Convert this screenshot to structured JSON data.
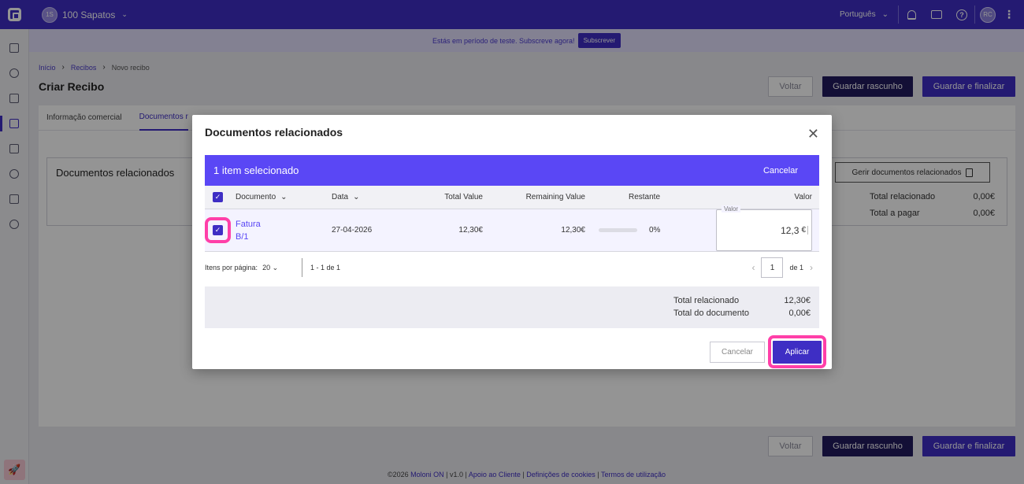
{
  "topbar": {
    "company_initials": "1S",
    "company_name": "100 Sapatos",
    "language": "Português",
    "user_initials": "RC"
  },
  "trial": {
    "message": "Estás em período de teste. Subscreve agora!",
    "subscribe_label": "Subscrever"
  },
  "breadcrumb": {
    "items": [
      "Início",
      "Recibos",
      "Novo recibo"
    ]
  },
  "page": {
    "title": "Criar Recibo",
    "back_label": "Voltar",
    "save_draft_label": "Guardar rascunho",
    "save_finalize_label": "Guardar e finalizar"
  },
  "tabs": [
    "Informação comercial",
    "Documentos r"
  ],
  "related_panel": {
    "title": "Documentos relacionados",
    "manage_label": "Gerir documentos relacionados",
    "total_related_label": "Total relacionado",
    "total_related_value": "0,00€",
    "total_pay_label": "Total a pagar",
    "total_pay_value": "0,00€"
  },
  "modal": {
    "title": "Documentos relacionados",
    "selection_text": "1 item selecionado",
    "selection_cancel": "Cancelar",
    "columns": {
      "documento": "Documento",
      "data": "Data",
      "total_value": "Total Value",
      "remaining_value": "Remaining Value",
      "restante": "Restante",
      "valor": "Valor"
    },
    "row": {
      "doc_line1": "Fatura",
      "doc_line2": "B/1",
      "date": "27-04-2026",
      "total_value": "12,30€",
      "remaining_value": "12,30€",
      "restante_pct": "0%",
      "restante_fraction": 0,
      "valor_label": "Valor",
      "valor": "12,3",
      "valor_unit": "€"
    },
    "pager": {
      "items_per_page_label": "Itens por página:",
      "items_per_page": "20",
      "range": "1 - 1 de 1",
      "page": "1",
      "of": "de 1"
    },
    "summary": {
      "related_label": "Total relacionado",
      "related_value": "12,30€",
      "doc_label": "Total do documento",
      "doc_value": "0,00€"
    },
    "cancel_label": "Cancelar",
    "apply_label": "Aplicar"
  },
  "footer": {
    "copyright": "©2026",
    "brand": "Moloni ON",
    "version": "| v1.0 |",
    "support": "Apoio ao Cliente",
    "cookies": "Definições de cookies",
    "terms": "Termos de utilização"
  },
  "colors": {
    "brand": "#3e2ec4",
    "selection_bar": "#5a47f5",
    "highlight": "#ff3fa8"
  }
}
